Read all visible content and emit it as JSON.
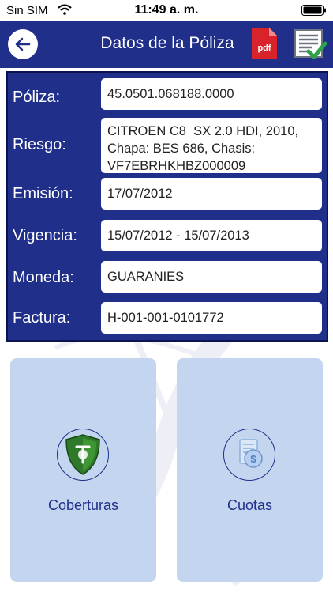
{
  "status": {
    "carrier": "Sin SIM",
    "time": "11:49 a. m."
  },
  "header": {
    "title": "Datos de la Póliza",
    "pdf_label": "pdf",
    "brand_color": "#1f2f8a",
    "icons": [
      "back-arrow-icon",
      "pdf-icon",
      "document-check-icon"
    ]
  },
  "fields": [
    {
      "label": "Póliza:",
      "value": "45.0501.068188.0000"
    },
    {
      "label": "Riesgo:",
      "value": "CITROEN C8  SX 2.0 HDI, 2010, Chapa: BES 686, Chasis: VF7EBRHKHBZ000009"
    },
    {
      "label": "Emisión:",
      "value": "17/07/2012"
    },
    {
      "label": "Vigencia:",
      "value": "15/07/2012 - 15/07/2013"
    },
    {
      "label": "Moneda:",
      "value": "GUARANIES"
    },
    {
      "label": "Factura:",
      "value": "H-001-001-0101772"
    }
  ],
  "tiles": [
    {
      "label": "Coberturas",
      "icon": "shield-icon"
    },
    {
      "label": "Cuotas",
      "icon": "coins-icon"
    }
  ]
}
